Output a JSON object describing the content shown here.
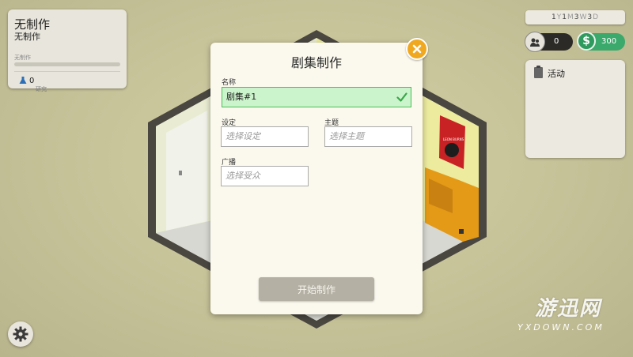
{
  "production_card": {
    "title": "无制作",
    "subtitle": "无制作",
    "status_small": "无制作",
    "research_count": "0",
    "research_label": "研究"
  },
  "hud": {
    "date": {
      "y_value": "1",
      "y_unit": "Y",
      "m_value": "1",
      "m_unit": "M",
      "w_value": "3",
      "w_unit": "W",
      "d_value": "3",
      "d_unit": "D"
    },
    "fans": "0",
    "money": "300",
    "money_symbol": "$",
    "activity_label": "活动"
  },
  "dialog": {
    "title": "剧集制作",
    "name_label": "名称",
    "name_value": "剧集#1",
    "setting_label": "设定",
    "setting_placeholder": "选择设定",
    "theme_label": "主题",
    "theme_placeholder": "选择主题",
    "broadcast_label": "广播",
    "broadcast_placeholder": "选择受众",
    "start_button": "开始制作"
  },
  "poster_text": "LEON BURNS",
  "watermark": {
    "main": "游迅网",
    "sub": "YXDOWN.COM"
  },
  "colors": {
    "accent_green": "#3aa96b",
    "close_orange": "#f0a820",
    "valid_green_bg": "#ccf4cc",
    "button_disabled": "#b5b0a4"
  },
  "icons": [
    "flask-icon",
    "fans-icon",
    "dollar-icon",
    "clipboard-icon",
    "gear-icon",
    "close-icon",
    "check-icon"
  ]
}
